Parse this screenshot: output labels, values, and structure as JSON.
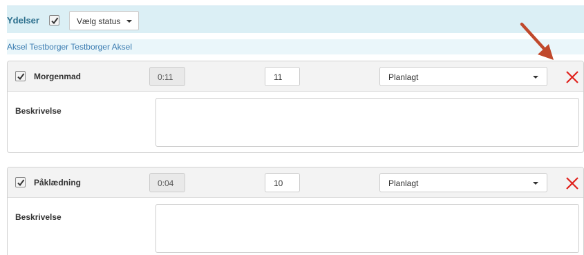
{
  "header": {
    "title": "Ydelser",
    "checked": true,
    "status_dropdown_label": "Vælg status"
  },
  "citizen": {
    "name": "Aksel Testborger Testborger Aksel"
  },
  "services": [
    {
      "checked": true,
      "name": "Morgenmad",
      "duration": "0:11",
      "quantity": "11",
      "status": "Planlagt",
      "description_label": "Beskrivelse",
      "description_value": ""
    },
    {
      "checked": true,
      "name": "Påklædning",
      "duration": "0:04",
      "quantity": "10",
      "status": "Planlagt",
      "description_label": "Beskrivelse",
      "description_value": ""
    }
  ],
  "colors": {
    "header_bg": "#dbeff5",
    "title_color": "#2a6e8c",
    "link_color": "#3b7cb1",
    "delete_color": "#e0201b",
    "annotation_arrow": "#c0492c"
  },
  "icons": {
    "checkbox": "checkmark-icon",
    "dropdown": "caret-down-icon",
    "delete": "close-icon",
    "annotation": "arrow-icon"
  }
}
